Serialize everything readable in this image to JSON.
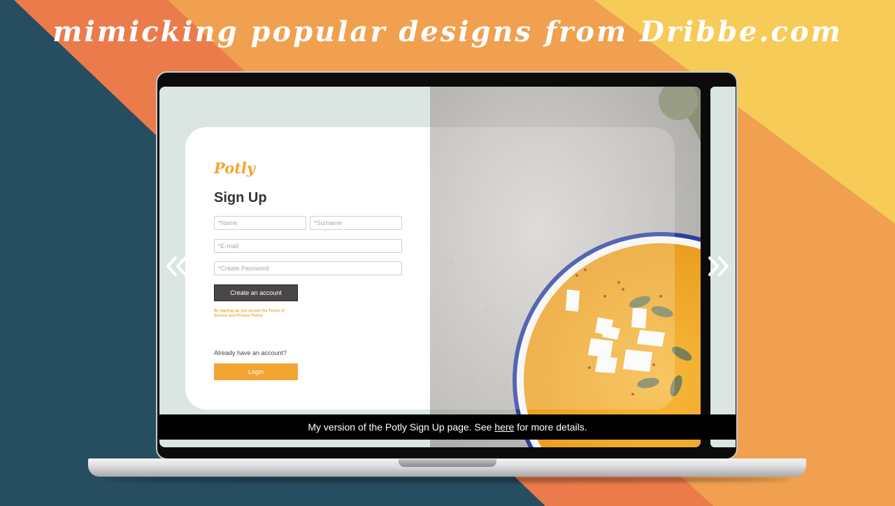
{
  "banner": {
    "text": "mimicking popular designs from Dribbe.com"
  },
  "signup": {
    "logo": "Potly",
    "title": "Sign Up",
    "name_placeholder": "*Name",
    "surname_placeholder": "*Surname",
    "email_placeholder": "*E-mail",
    "password_placeholder": "*Create Password",
    "create_button": "Create an account",
    "terms_text": "By signing up you accept the Terms of Service and Privacy Policy",
    "already_text": "Already have an account?",
    "login_button": "Login"
  },
  "carousel": {
    "prev_icon": "double-chevron-left",
    "next_icon": "double-chevron-right"
  },
  "caption": {
    "prefix": "My version of the Potly Sign Up page. See",
    "link": "here",
    "suffix": "for more details."
  },
  "colors": {
    "navy": "#274e60",
    "coral": "#ec7b4b",
    "orange": "#f0a04f",
    "yellow": "#f6cb58",
    "accent": "#f2a532",
    "mint": "#dbe6e3",
    "dark_button": "#4a4646"
  }
}
